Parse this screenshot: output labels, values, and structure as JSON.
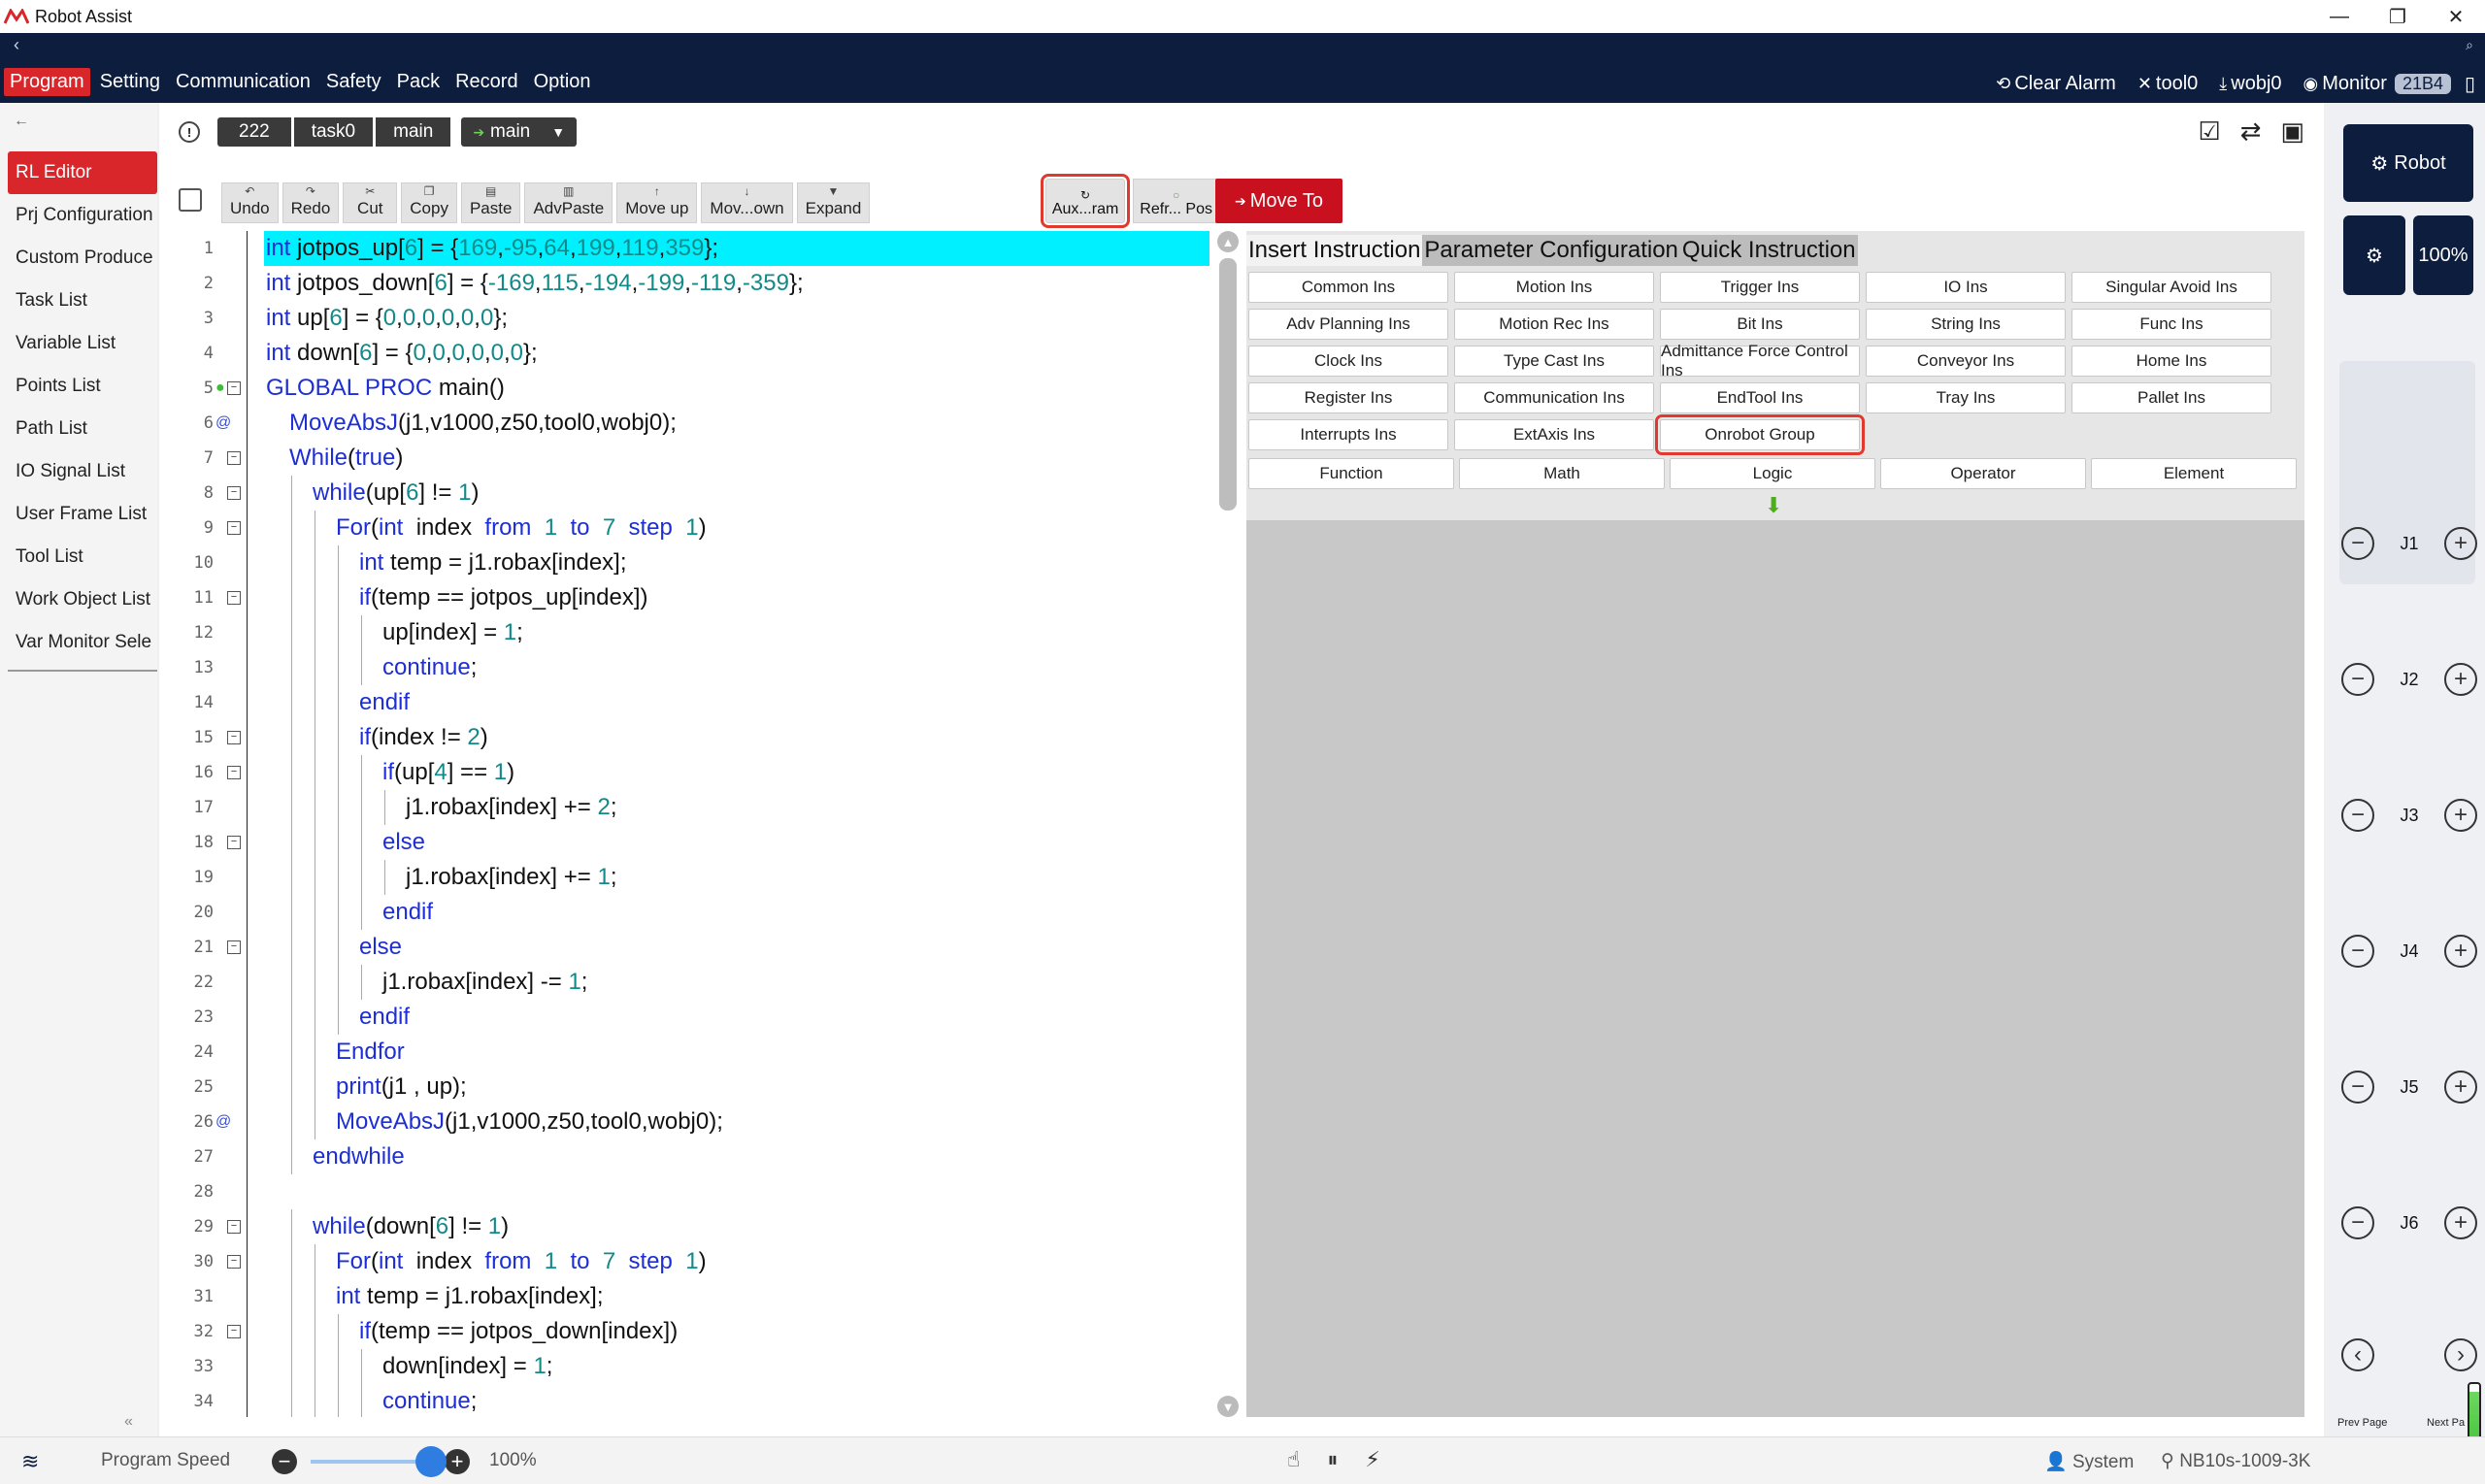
{
  "app": {
    "title": "Robot Assist"
  },
  "menu": [
    "Program",
    "Setting",
    "Communication",
    "Safety",
    "Pack",
    "Record",
    "Option"
  ],
  "right_tools": {
    "clear_alarm": "Clear Alarm",
    "tool": "tool0",
    "wobj": "wobj0",
    "monitor": "Monitor",
    "badge": "21B4"
  },
  "sidebar": {
    "items": [
      "RL Editor",
      "Prj Configuration",
      "Custom Produce",
      "Task List",
      "Variable List",
      "Points List",
      "Path List",
      "IO Signal List",
      "User Frame List",
      "Tool List",
      "Work Object List",
      "Var Monitor Sele"
    ]
  },
  "breadcrumb": {
    "items": [
      "222",
      "task0",
      "main"
    ],
    "dropdown": "main"
  },
  "toolbar": {
    "buttons": [
      "Undo",
      "Redo",
      "Cut",
      "Copy",
      "Paste",
      "AdvPaste",
      "Move up",
      "Mov...own",
      "Expand"
    ]
  },
  "actions": {
    "aux": "Aux...ram",
    "refresh": "Refr... Pos",
    "move_to": "Move To"
  },
  "panel": {
    "tabs": [
      "Insert Instruction",
      "Parameter Configuration",
      "Quick Instruction"
    ],
    "groups": [
      "Common Ins",
      "Motion Ins",
      "Trigger Ins",
      "IO Ins",
      "Singular Avoid Ins",
      "Adv Planning Ins",
      "Motion Rec Ins",
      "Bit Ins",
      "String Ins",
      "Func Ins",
      "Clock Ins",
      "Type Cast Ins",
      "Admittance Force Control Ins",
      "Conveyor Ins",
      "Home Ins",
      "Register Ins",
      "Communication Ins",
      "EndTool Ins",
      "Tray Ins",
      "Pallet Ins",
      "Interrupts Ins",
      "ExtAxis Ins",
      "Onrobot Group"
    ],
    "categories": [
      "Function",
      "Math",
      "Logic",
      "Operator",
      "Element"
    ]
  },
  "robot_panel": {
    "robot": "Robot",
    "speed": "100%",
    "joints": [
      "J1",
      "J2",
      "J3",
      "J4",
      "J5",
      "J6"
    ],
    "prev_page": "Prev Page",
    "next_page": "Next Pa"
  },
  "status": {
    "program_speed_label": "Program Speed",
    "program_speed": "100%",
    "user": "System",
    "device": "NB10s-1009-3K"
  },
  "colors": {
    "accent": "#d9262b",
    "nav": "#0d1d3e",
    "highlight_line": "#00f0ff",
    "highlight_box": "#e03a2f"
  },
  "code": [
    {
      "n": "1",
      "indent": 0,
      "text": "int jotpos_up[6] = {169,-95,64,199,119,359};"
    },
    {
      "n": "2",
      "indent": 0,
      "text": "int jotpos_down[6] = {-169,115,-194,-199,-119,-359};"
    },
    {
      "n": "3",
      "indent": 0,
      "text": "int up[6] = {0,0,0,0,0,0};"
    },
    {
      "n": "4",
      "indent": 0,
      "text": "int down[6] = {0,0,0,0,0,0};"
    },
    {
      "n": "5",
      "indent": 0,
      "text": "GLOBAL PROC main()",
      "fold": true,
      "mark": "●"
    },
    {
      "n": "6",
      "indent": 1,
      "text": "MoveAbsJ(j1,v1000,z50,tool0,wobj0);",
      "mark": "@"
    },
    {
      "n": "7",
      "indent": 1,
      "text": "While(true)",
      "fold": true
    },
    {
      "n": "8",
      "indent": 2,
      "text": "while(up[6] != 1)",
      "fold": true
    },
    {
      "n": "9",
      "indent": 3,
      "text": "For(int  index  from  1  to  7  step  1)",
      "fold": true
    },
    {
      "n": "10",
      "indent": 4,
      "text": "int temp = j1.robax[index];"
    },
    {
      "n": "11",
      "indent": 4,
      "text": "if(temp == jotpos_up[index])",
      "fold": true
    },
    {
      "n": "12",
      "indent": 5,
      "text": "up[index] = 1;"
    },
    {
      "n": "13",
      "indent": 5,
      "text": "continue;"
    },
    {
      "n": "14",
      "indent": 4,
      "text": "endif"
    },
    {
      "n": "15",
      "indent": 4,
      "text": "if(index != 2)",
      "fold": true
    },
    {
      "n": "16",
      "indent": 5,
      "text": "if(up[4] == 1)",
      "fold": true
    },
    {
      "n": "17",
      "indent": 6,
      "text": "j1.robax[index] += 2;"
    },
    {
      "n": "18",
      "indent": 5,
      "text": "else",
      "fold": true
    },
    {
      "n": "19",
      "indent": 6,
      "text": "j1.robax[index] += 1;"
    },
    {
      "n": "20",
      "indent": 5,
      "text": "endif"
    },
    {
      "n": "21",
      "indent": 4,
      "text": "else",
      "fold": true
    },
    {
      "n": "22",
      "indent": 5,
      "text": "j1.robax[index] -= 1;"
    },
    {
      "n": "23",
      "indent": 4,
      "text": "endif"
    },
    {
      "n": "24",
      "indent": 3,
      "text": "Endfor"
    },
    {
      "n": "25",
      "indent": 3,
      "text": "print(j1 , up);"
    },
    {
      "n": "26",
      "indent": 3,
      "text": "MoveAbsJ(j1,v1000,z50,tool0,wobj0);",
      "mark": "@"
    },
    {
      "n": "27",
      "indent": 2,
      "text": "endwhile"
    },
    {
      "n": "28",
      "indent": 0,
      "text": ""
    },
    {
      "n": "29",
      "indent": 2,
      "text": "while(down[6] != 1)",
      "fold": true
    },
    {
      "n": "30",
      "indent": 3,
      "text": "For(int  index  from  1  to  7  step  1)",
      "fold": true
    },
    {
      "n": "31",
      "indent": 3,
      "text": "int temp = j1.robax[index];"
    },
    {
      "n": "32",
      "indent": 4,
      "text": "if(temp == jotpos_down[index])",
      "fold": true
    },
    {
      "n": "33",
      "indent": 5,
      "text": "down[index] = 1;"
    },
    {
      "n": "34",
      "indent": 5,
      "text": "continue;"
    }
  ]
}
